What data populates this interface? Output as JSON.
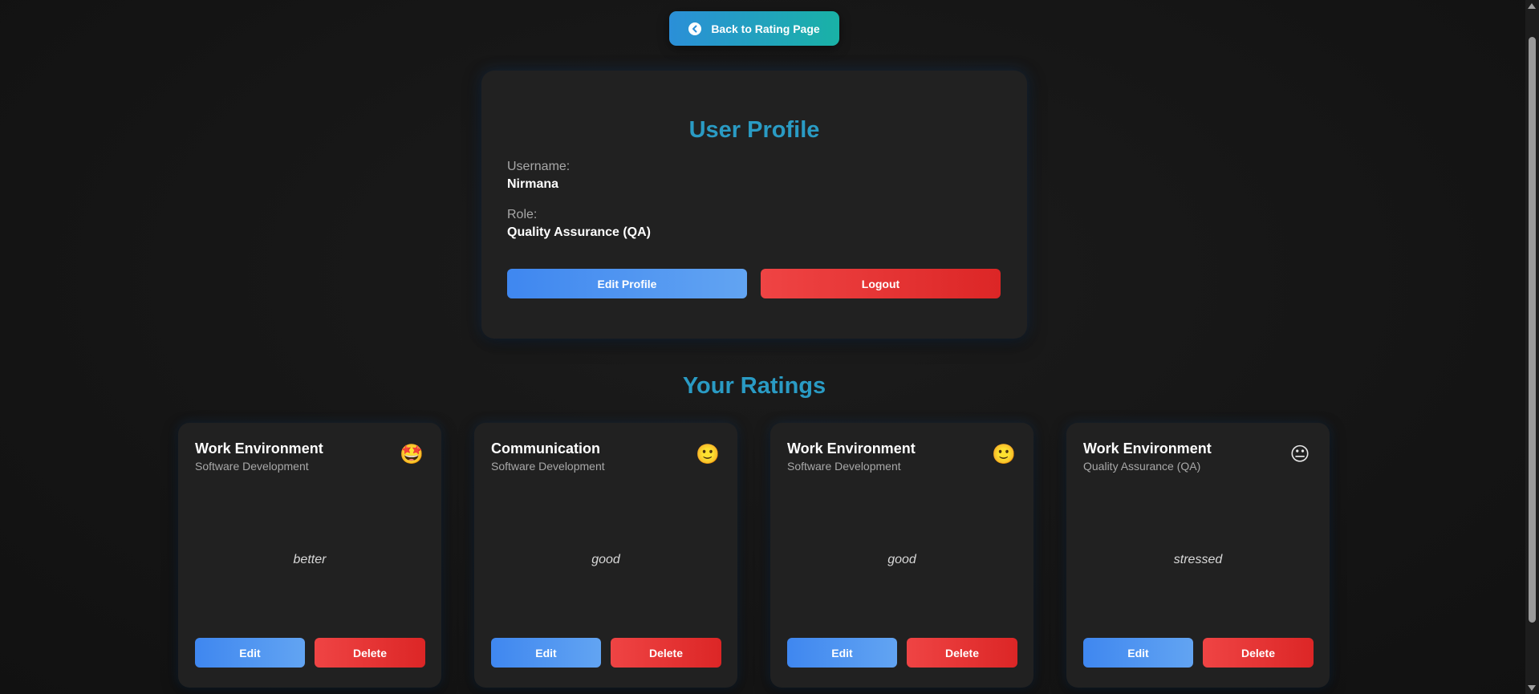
{
  "back_button": {
    "label": "Back to Rating Page",
    "icon": "arrow-left-circle-icon"
  },
  "profile": {
    "title": "User Profile",
    "username_label": "Username:",
    "username": "Nirmana",
    "role_label": "Role:",
    "role": "Quality Assurance (QA)",
    "edit_label": "Edit Profile",
    "logout_label": "Logout"
  },
  "ratings": {
    "title": "Your Ratings",
    "items": [
      {
        "category": "Work Environment",
        "department": "Software Development",
        "emoji": "🤩",
        "comment": "better",
        "edit_label": "Edit",
        "delete_label": "Delete"
      },
      {
        "category": "Communication",
        "department": "Software Development",
        "emoji": "🙂",
        "comment": "good",
        "edit_label": "Edit",
        "delete_label": "Delete"
      },
      {
        "category": "Work Environment",
        "department": "Software Development",
        "emoji": "🙂",
        "comment": "good",
        "edit_label": "Edit",
        "delete_label": "Delete"
      },
      {
        "category": "Work Environment",
        "department": "Quality Assurance (QA)",
        "emoji": "😐",
        "comment": "stressed",
        "edit_label": "Edit",
        "delete_label": "Delete"
      }
    ]
  },
  "colors": {
    "accent_title": "#2a9bc4",
    "primary_button": "#3f87f0",
    "danger_button": "#ef4444",
    "back_button_gradient": [
      "#2b8fd8",
      "#19b2a6"
    ],
    "card_background": "#212121",
    "page_background": "#141414"
  }
}
